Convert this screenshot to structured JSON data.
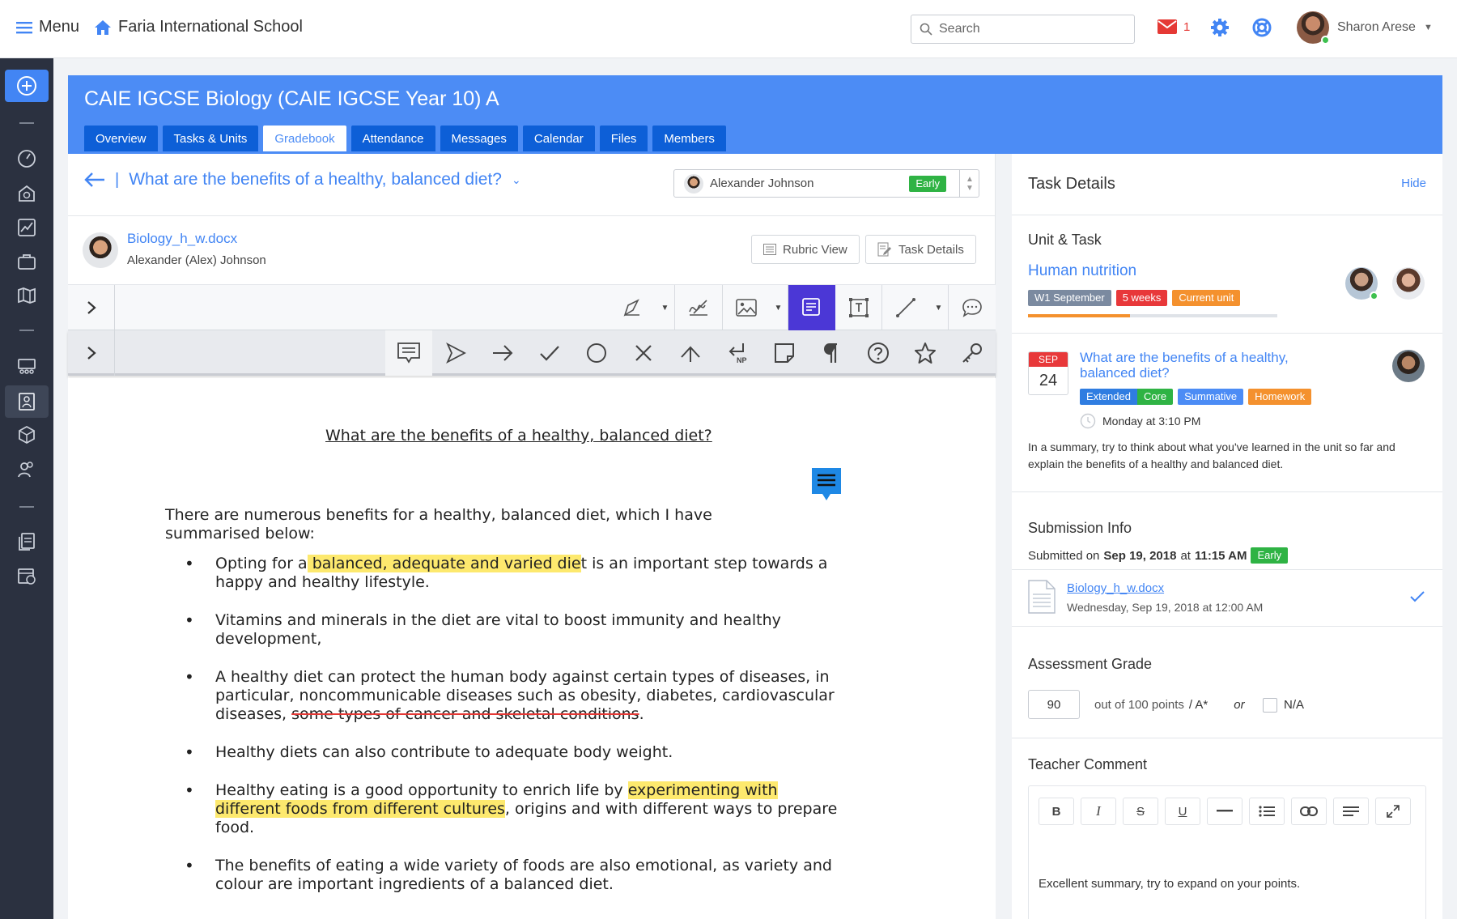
{
  "topbar": {
    "menu_label": "Menu",
    "school_name": "Faria International School",
    "search_placeholder": "Search",
    "mail_count": "1",
    "user_name": "Sharon Arese"
  },
  "class": {
    "title": "CAIE IGCSE Biology (CAIE IGCSE Year 10) A",
    "tabs": [
      {
        "label": "Overview"
      },
      {
        "label": "Tasks & Units"
      },
      {
        "label": "Gradebook",
        "active": true
      },
      {
        "label": "Attendance"
      },
      {
        "label": "Messages"
      },
      {
        "label": "Calendar"
      },
      {
        "label": "Files"
      },
      {
        "label": "Members"
      }
    ]
  },
  "task_header": {
    "question": "What are the benefits of a healthy, balanced diet?",
    "student": "Alexander Johnson",
    "status": "Early"
  },
  "submission_file": {
    "file_name": "Biology_h_w.docx",
    "student_full": "Alexander (Alex) Johnson",
    "rubric_view": "Rubric View",
    "task_details": "Task Details"
  },
  "document": {
    "title": "What are the benefits of a healthy, balanced diet?",
    "intro": "There are numerous benefits for a healthy, balanced diet, which I have summarised below:",
    "b1_pre": "Opting for a",
    "b1_hl": " balanced, adequate and varied die",
    "b1_post": "t is an important step towards a happy and healthy lifestyle.",
    "b2": "Vitamins and minerals in the diet are vital to boost immunity and healthy development,",
    "b3_pre": "A healthy diet can protect the human body against certain types of diseases, in particular, noncommunicable diseases such as obesity, diabetes, cardiovascular diseases, ",
    "b3_strike": "some types of cancer and skeletal conditions",
    "b3_post": ".",
    "b4": "Healthy diets can also contribute to adequate body weight.",
    "b5_pre": "Healthy eating is a good opportunity to enrich life by ",
    "b5_hl": "experimenting with different foods from different cultures",
    "b5_post": ", origins and with different ways to prepare food.",
    "b6": "The benefits of eating a wide variety of foods are also emotional, as variety and colour are important ingredients of a balanced diet."
  },
  "task_details": {
    "heading": "Task Details",
    "hide": "Hide",
    "unit_task_label": "Unit & Task",
    "unit_name": "Human nutrition",
    "unit_badges": [
      "W1 September",
      "5 weeks",
      "Current unit"
    ],
    "unit_progress": 0.41,
    "cal_month": "SEP",
    "cal_day": "24",
    "task_title": "What are the benefits of a healthy, balanced diet?",
    "task_badges": [
      "Extended",
      "Core",
      "Summative",
      "Homework"
    ],
    "due": "Monday at 3:10 PM",
    "description": "In a summary,  try to think about what you've learned in the unit so far and explain the benefits of a healthy and balanced diet."
  },
  "submission_info": {
    "label": "Submission Info",
    "submitted_on": "Submitted on",
    "date": "Sep 19, 2018",
    "at": "at",
    "time": "11:15 AM",
    "status": "Early",
    "file_name": "Biology_h_w.docx",
    "file_date": "Wednesday, Sep 19, 2018 at 12:00 AM"
  },
  "assessment": {
    "label": "Assessment Grade",
    "grade": "90",
    "out_of": "out of 100 points",
    "slash_grade": "/ A*",
    "or": "or",
    "na": "N/A"
  },
  "teacher_comment": {
    "label": "Teacher Comment",
    "text": "Excellent summary, try to expand on your points."
  },
  "colors": {
    "brand_blue": "#4c8cf5",
    "tab_blue": "#0d5fd7",
    "rail": "#2b3140",
    "highlight": "#fde96e",
    "early_green": "#2fb344"
  }
}
